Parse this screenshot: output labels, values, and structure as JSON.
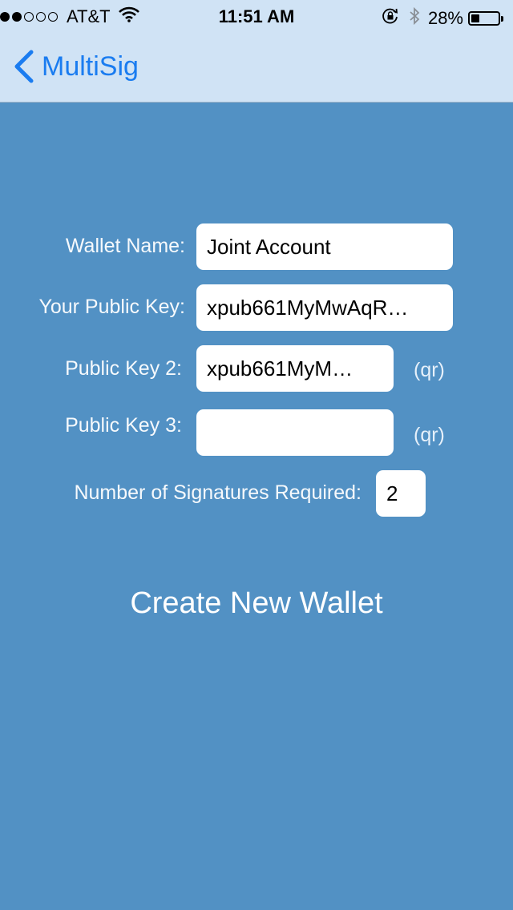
{
  "status_bar": {
    "carrier": "AT&T",
    "time": "11:51 AM",
    "battery": "28%"
  },
  "nav": {
    "back_label": "MultiSig"
  },
  "form": {
    "wallet_name_label": "Wallet Name:",
    "wallet_name_value": "Joint Account",
    "your_key_label": "Your Public Key:",
    "your_key_value": "xpub661MyMwAqR…",
    "key2_label": "Public Key 2:",
    "key2_value": "xpub661MyM…",
    "key2_qr": "(qr)",
    "key3_label": "Public Key 3:",
    "key3_value": "",
    "key3_qr": "(qr)",
    "sigs_label": "Number of Signatures Required:",
    "sigs_value": "2"
  },
  "actions": {
    "create_label": "Create New Wallet"
  },
  "colors": {
    "background": "#5291C4",
    "nav_bar": "#D0E3F5",
    "accent": "#1A7CF0"
  },
  "icons": [
    "signal-dots-icon",
    "wifi-icon",
    "rotation-lock-icon",
    "bluetooth-icon",
    "battery-icon",
    "chevron-left-icon"
  ]
}
